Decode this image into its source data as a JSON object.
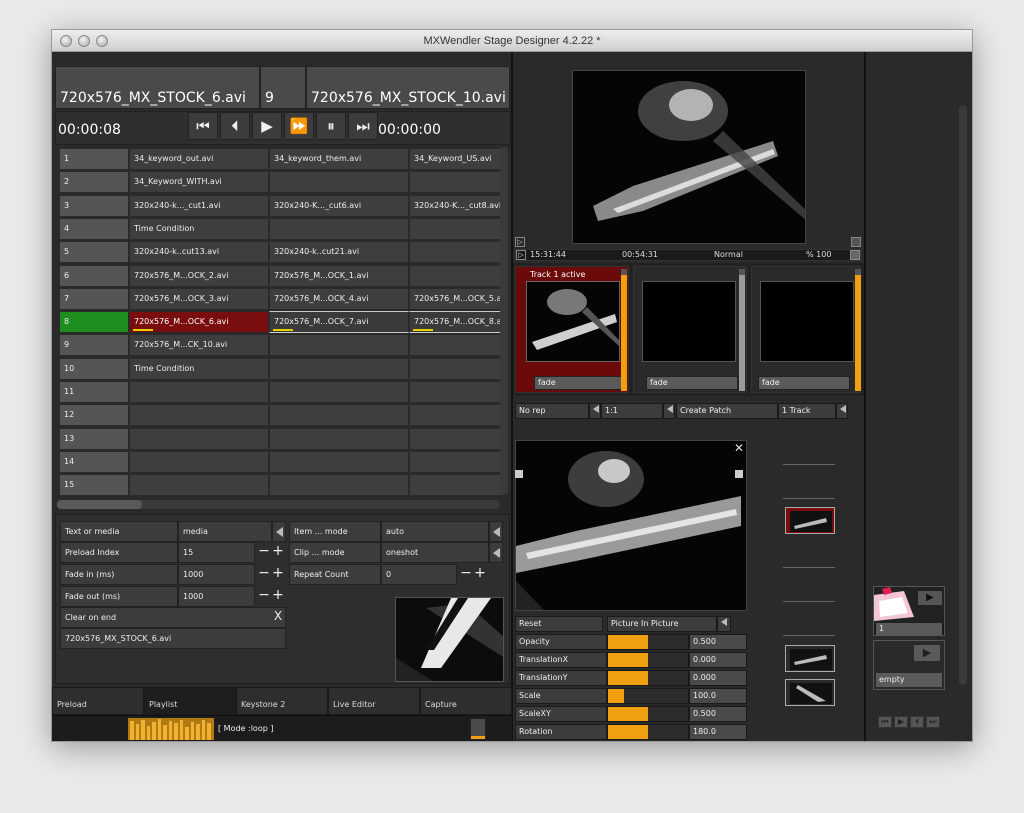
{
  "window": {
    "title": "MXWendler Stage Designer 4.2.22  *"
  },
  "header": {
    "left_clip": "720x576_MX_STOCK_6.avi",
    "index": "9",
    "right_clip": "720x576_MX_STOCK_10.avi",
    "time_left": "00:00:08",
    "time_right": "00:00:00",
    "transport": [
      "⏮",
      "⏴",
      "▶",
      "⏩",
      "⏸",
      "⏭"
    ]
  },
  "grid": {
    "rows": [
      {
        "num": "1",
        "cells": [
          "34_keyword_out.avi",
          "34_keyword_them.avi",
          "34_Keyword_US.avi"
        ]
      },
      {
        "num": "2",
        "cells": [
          "34_Keyword_WITH.avi",
          "",
          ""
        ]
      },
      {
        "num": "3",
        "cells": [
          "320x240-k..._cut1.avi",
          "320x240-K..._cut6.avi",
          "320x240-K..._cut8.avi"
        ]
      },
      {
        "num": "4",
        "cells": [
          "Time Condition",
          "",
          ""
        ]
      },
      {
        "num": "5",
        "cells": [
          "320x240-k..cut13.avi",
          "320x240-k..cut21.avi",
          ""
        ]
      },
      {
        "num": "6",
        "cells": [
          "720x576_M...OCK_2.avi",
          "720x576_M...OCK_1.avi",
          ""
        ]
      },
      {
        "num": "7",
        "cells": [
          "720x576_M...OCK_3.avi",
          "720x576_M...OCK_4.avi",
          "720x576_M...OCK_5.avi"
        ]
      },
      {
        "num": "8",
        "cells": [
          "720x576_M...OCK_6.avi",
          "720x576_M...OCK_7.avi",
          "720x576_M...OCK_8.a"
        ]
      },
      {
        "num": "9",
        "cells": [
          "720x576_M...CK_10.avi",
          "",
          ""
        ]
      },
      {
        "num": "10",
        "cells": [
          "Time Condition",
          "",
          ""
        ]
      },
      {
        "num": "11",
        "cells": [
          "",
          "",
          ""
        ]
      },
      {
        "num": "12",
        "cells": [
          "",
          "",
          ""
        ]
      },
      {
        "num": "13",
        "cells": [
          "",
          "",
          ""
        ]
      },
      {
        "num": "14",
        "cells": [
          "",
          "",
          ""
        ]
      },
      {
        "num": "15",
        "cells": [
          "",
          "",
          ""
        ]
      }
    ]
  },
  "props": {
    "text_or_media_label": "Text or media",
    "text_or_media_value": "media",
    "preload_index_label": "Preload Index",
    "preload_index_value": "15",
    "fade_in_label": "Fade in (ms)",
    "fade_in_value": "1000",
    "fade_out_label": "Fade out (ms)",
    "fade_out_value": "1000",
    "clear_on_end_label": "Clear on end",
    "clip_name": "720x576_MX_STOCK_6.avi",
    "item_mode_label": "Item ... mode",
    "item_mode_value": "auto",
    "clip_mode_label": "Clip ... mode",
    "clip_mode_value": "oneshot",
    "repeat_count_label": "Repeat Count",
    "repeat_count_value": "0",
    "minus": "−",
    "plus": "+",
    "close": "X"
  },
  "tabs": [
    "Preload",
    "Playlist",
    "Keystone 2",
    "Live Editor",
    "Capture"
  ],
  "timeline": {
    "mode_text": "[ Mode :loop ]"
  },
  "preview": {
    "time_a": "15:31:44",
    "time_b": "00:54:31",
    "blend": "Normal",
    "zoom": "% 100"
  },
  "tracks": [
    {
      "label": "Track 1 active",
      "fade": "fade",
      "level": 0.95
    },
    {
      "label": "",
      "fade": "fade",
      "level": 0.95
    },
    {
      "label": "",
      "fade": "fade",
      "level": 0.95
    }
  ],
  "patch_bar": {
    "rep": "No rep",
    "ratio": "1:1",
    "create": "Create Patch",
    "track": "1 Track"
  },
  "effect": {
    "reset": "Reset",
    "mode": "Picture In Picture",
    "params": [
      {
        "label": "Opacity",
        "value": "0.500",
        "level": 0.5
      },
      {
        "label": "TranslationX",
        "value": "0.000",
        "level": 0.5
      },
      {
        "label": "TranslationY",
        "value": "0.000",
        "level": 0.5
      },
      {
        "label": "Scale",
        "value": "100.0",
        "level": 0.2
      },
      {
        "label": "ScaleXY",
        "value": "0.500",
        "level": 0.5
      },
      {
        "label": "Rotation",
        "value": "180.0",
        "level": 0.5
      }
    ]
  },
  "right_panel": {
    "slot1_label": "1",
    "slot2_label": "empty"
  },
  "colors": {
    "accent_orange": "#f0a010",
    "active_green": "#1e8f1e",
    "active_red": "#7a0d0d",
    "highlight_yellow": "#e5d000"
  }
}
